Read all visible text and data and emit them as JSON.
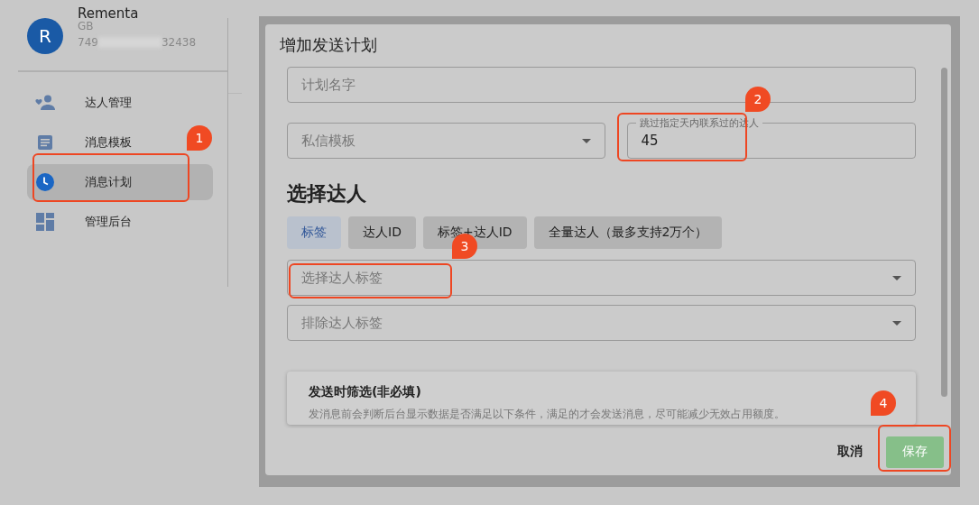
{
  "sidebar": {
    "profile": {
      "avatar": "R",
      "name": "Rementa",
      "line_1": "GB",
      "line_2_start": "749",
      "line_2_end": "32438"
    },
    "items": [
      {
        "label": "达人管理",
        "kind": "people",
        "selected": false
      },
      {
        "label": "消息模板",
        "kind": "document",
        "selected": false
      },
      {
        "label": "消息计划",
        "kind": "clock",
        "selected": true
      },
      {
        "label": "管理后台",
        "kind": "dashboard",
        "selected": false
      }
    ]
  },
  "dialog": {
    "title": "增加发送计划",
    "plan_name": {
      "placeholder": "计划名字"
    },
    "template_select": {
      "placeholder": "私信模板"
    },
    "skip_days": {
      "label": "跳过指定天内联系过的达人",
      "value": "45"
    },
    "section_title": "选择达人",
    "tabs": [
      {
        "label": "标签",
        "selected": true
      },
      {
        "label": "达人ID",
        "selected": false
      },
      {
        "label": "标签+达人ID",
        "selected": false
      },
      {
        "label": "全量达人（最多支持2万个）",
        "selected": false
      }
    ],
    "tag_select": {
      "placeholder": "选择达人标签"
    },
    "exclude_select": {
      "placeholder": "排除达人标签"
    },
    "filter_card": {
      "title": "发送时筛选(非必填)",
      "description": "发消息前会判断后台显示数据是否满足以下条件，满足的才会发送消息，尽可能减少无效占用额度。"
    },
    "cancel_button": "取消",
    "save_button": {
      "label": "保存",
      "disabled": true
    }
  },
  "annotations": [
    {
      "number": "1"
    },
    {
      "number": "2"
    },
    {
      "number": "3"
    },
    {
      "number": "4"
    }
  ]
}
